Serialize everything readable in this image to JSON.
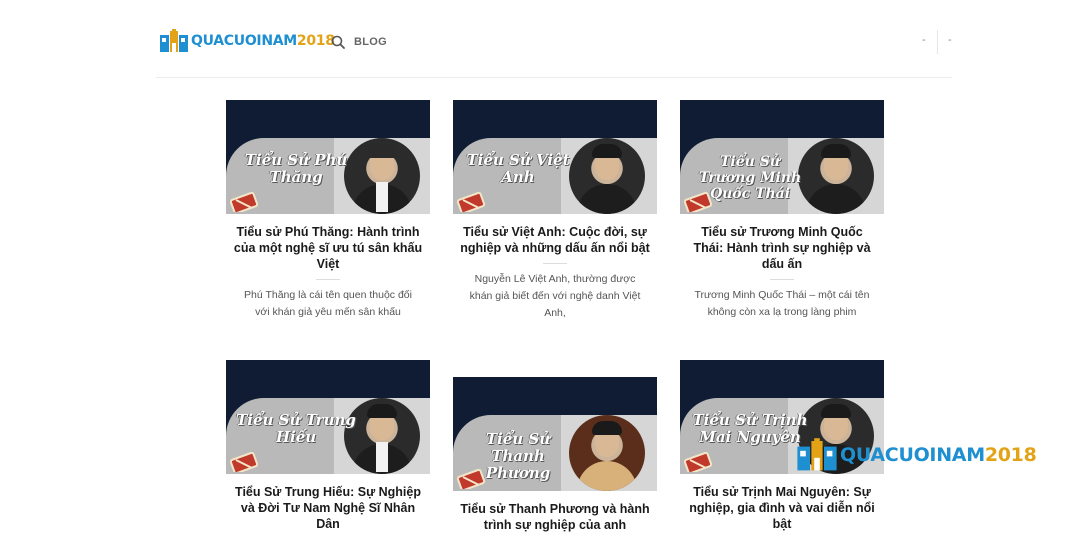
{
  "header": {
    "logo_text_part1": "QUACUOINAM",
    "logo_text_part2": "2018",
    "nav_blog": "BLOG",
    "menu_dash_1": "-",
    "menu_dash_2": "-"
  },
  "colors": {
    "logo_blue": "#1e8fd0",
    "logo_gold": "#e2a316",
    "thumb_navy": "#0f1c33",
    "thumb_band": "#b9b9b9"
  },
  "posts": [
    {
      "thumb_title": "Tiểu Sử Phú Thăng",
      "title": "Tiểu sử Phú Thăng: Hành trình của một nghệ sĩ ưu tú sân khấu Việt",
      "excerpt": "Phú Thăng là cái tên quen thuộc đối với khán giả yêu mến sân khấu"
    },
    {
      "thumb_title": "Tiểu Sử Việt Anh",
      "title": "Tiểu sử Việt Anh: Cuộc đời, sự nghiệp và những dấu ấn nổi bật",
      "excerpt": "Nguyễn Lê Việt Anh, thường được khán giả biết đến với nghệ danh Việt Anh,"
    },
    {
      "thumb_title": "Tiểu Sử Trương Minh Quốc Thái",
      "title": "Tiểu sử Trương Minh Quốc Thái: Hành trình sự nghiệp và dấu ấn",
      "excerpt": "Trương Minh Quốc Thái – một cái tên không còn xa lạ trong làng phim"
    },
    {
      "thumb_title": "Tiểu Sử Trung Hiếu",
      "title": "Tiểu Sử Trung Hiếu: Sự Nghiệp và Đời Tư Nam Nghệ Sĩ Nhân Dân",
      "excerpt": ""
    },
    {
      "thumb_title": "Tiểu Sử Thanh Phương",
      "title": "Tiểu sử Thanh Phương và hành trình sự nghiệp của anh",
      "excerpt": ""
    },
    {
      "thumb_title": "Tiểu Sử Trịnh Mai Nguyên",
      "title": "Tiểu sử Trịnh Mai Nguyên: Sự nghiệp, gia đình và vai diễn nổi bật",
      "excerpt": ""
    }
  ],
  "watermark": {
    "text_part1": "QUACUOINAM",
    "text_part2": "2018"
  }
}
